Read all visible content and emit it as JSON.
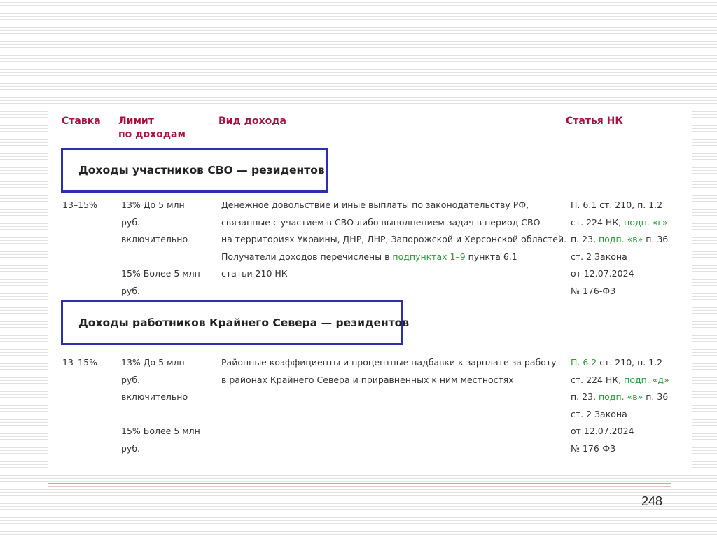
{
  "headers": {
    "rate": "Ставка",
    "limit_line1": "Лимит",
    "limit_line2": "по доходам",
    "income": "Вид дохода",
    "article": "Статья НК"
  },
  "sections": [
    {
      "title": "Доходы участников СВО — резидентов",
      "rate": "13–15%",
      "limit": [
        "13% До 5 млн",
        "руб.",
        "включительно",
        "15% Более 5 млн",
        "руб."
      ],
      "income": {
        "line1": "Денежное довольствие и иные выплаты по законодательству РФ,",
        "line2": "связанные с участием в СВО либо выполнением задач в период СВО",
        "line3": "на территориях Украины, ДНР, ЛНР, Запорожской и Херсонской областей.",
        "line4_pre": "Получатели доходов перечислены в ",
        "line4_link": "подпунктах 1–9",
        "line4_post": " пункта 6.1",
        "line5": "статьи 210 НК"
      },
      "article": {
        "l1_link": "",
        "l1": "П. 6.1 ст. 210, п. 1.2",
        "l2_pre": "ст. 224 НК, ",
        "l2_link": "подп. «г»",
        "l3_pre": "п. 23, ",
        "l3_link": "подп. «в»",
        "l3_post": " п. 36",
        "l4": "ст. 2 Закона",
        "l5": "от 12.07.2024",
        "l6": "№ 176-ФЗ"
      }
    },
    {
      "title": "Доходы работников Крайнего Севера — резидентов",
      "rate": "13–15%",
      "limit": [
        "13% До 5 млн",
        "руб.",
        "включительно",
        "15% Более 5 млн",
        "руб."
      ],
      "income": {
        "line1": "Районные коэффициенты и процентные надбавки к зарплате за работу",
        "line2": "в районах Крайнего Севера и приравненных к ним местностях"
      },
      "article": {
        "l1_link": "П. 6.2",
        "l1": " ст. 210, п. 1.2",
        "l2_pre": "ст. 224 НК, ",
        "l2_link": "подп. «д»",
        "l3_pre": "п. 23, ",
        "l3_link": "подп. «в»",
        "l3_post": " п. 36",
        "l4": "ст. 2 Закона",
        "l5": "от 12.07.2024",
        "l6": "№ 176-ФЗ"
      }
    }
  ],
  "page_number": "248",
  "colors": {
    "header": "#a8123f",
    "link": "#2e9a3b",
    "box_border": "#2b2fb0"
  }
}
